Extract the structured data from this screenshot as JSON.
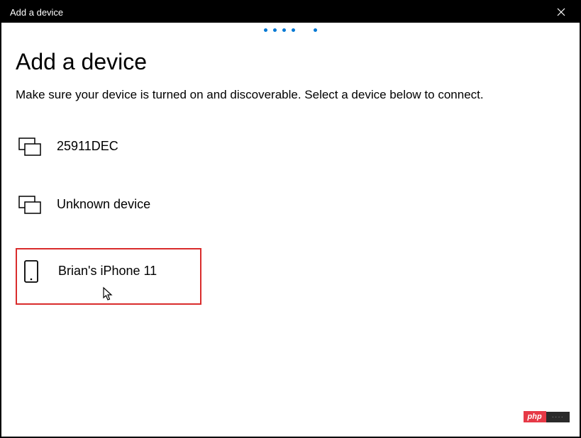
{
  "titlebar": {
    "title": "Add a device"
  },
  "main": {
    "heading": "Add a device",
    "subtext": "Make sure your device is turned on and discoverable. Select a device below to connect."
  },
  "devices": [
    {
      "name": "25911DEC",
      "icon": "displays"
    },
    {
      "name": "Unknown device",
      "icon": "displays"
    },
    {
      "name": "Brian's iPhone 11",
      "icon": "phone"
    }
  ],
  "watermark": {
    "left": "php",
    "right": "····"
  }
}
